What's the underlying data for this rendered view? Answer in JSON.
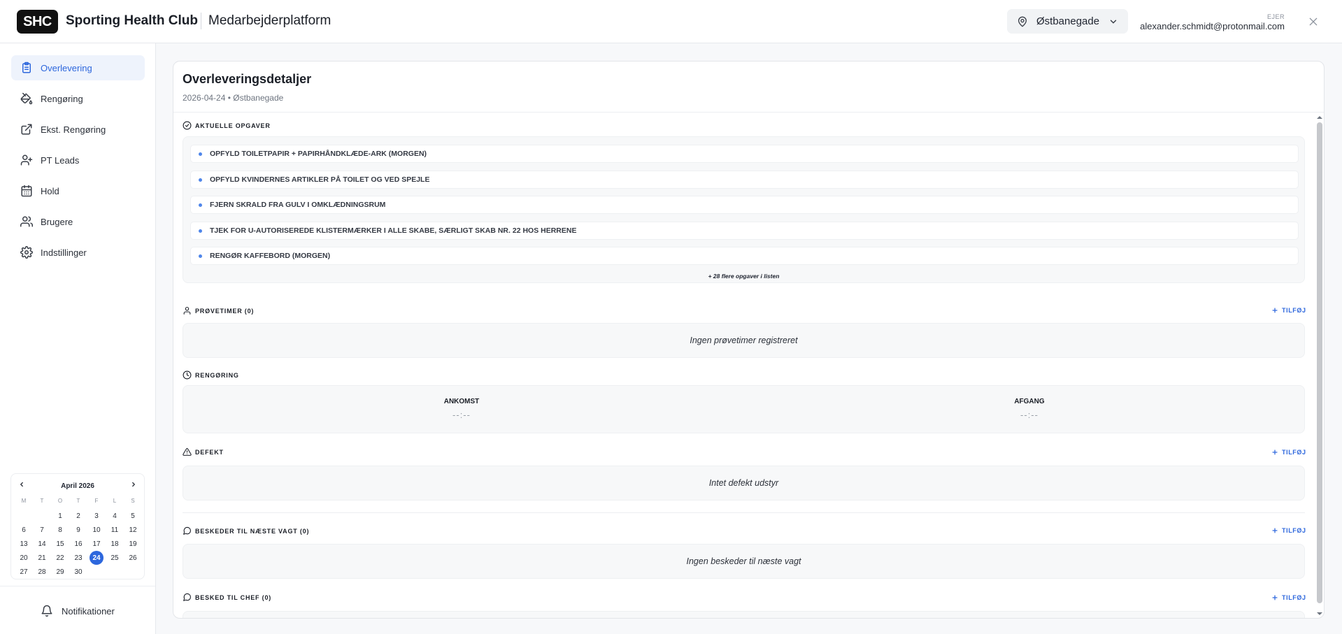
{
  "header": {
    "logo": "SHC",
    "brand": "Sporting Health Club",
    "platform": "Medarbejderplatform",
    "location": "Østbanegade",
    "role": "EJER",
    "email": "alexander.schmidt@protonmail.com"
  },
  "sidebar": {
    "items": [
      {
        "label": "Overlevering",
        "icon": "clipboard-icon",
        "active": true
      },
      {
        "label": "Rengøring",
        "icon": "paint-bucket-icon"
      },
      {
        "label": "Ekst. Rengøring",
        "icon": "external-link-icon"
      },
      {
        "label": "PT Leads",
        "icon": "user-plus-icon"
      },
      {
        "label": "Hold",
        "icon": "calendar-icon"
      },
      {
        "label": "Brugere",
        "icon": "users-icon"
      },
      {
        "label": "Indstillinger",
        "icon": "gear-icon"
      }
    ],
    "notifications": "Notifikationer"
  },
  "calendar": {
    "month": "April 2026",
    "weekdays": [
      "M",
      "T",
      "O",
      "T",
      "F",
      "L",
      "S"
    ],
    "days": [
      "",
      "",
      "1",
      "2",
      "3",
      "4",
      "5",
      "6",
      "7",
      "8",
      "9",
      "10",
      "11",
      "12",
      "13",
      "14",
      "15",
      "16",
      "17",
      "18",
      "19",
      "20",
      "21",
      "22",
      "23",
      "24",
      "25",
      "26",
      "27",
      "28",
      "29",
      "30"
    ],
    "selected": "24"
  },
  "main": {
    "title": "Overleveringsdetaljer",
    "subtitle": "2026-04-24 • Østbanegade",
    "tasks_heading": "AKTUELLE OPGAVER",
    "tasks": [
      "OPFYLD TOILETPAPIR + PAPIRHÅNDKLÆDE-ARK (MORGEN)",
      "OPFYLD KVINDERNES ARTIKLER PÅ TOILET OG VED SPEJLE",
      "FJERN SKRALD FRA GULV I OMKLÆDNINGSRUM",
      "TJEK FOR U-AUTORISEREDE KLISTERMÆRKER I ALLE SKABE, SÆRLIGT SKAB NR. 22 HOS HERRENE",
      "RENGØR KAFFEBORD (MORGEN)"
    ],
    "tasks_more": "+ 28 flere opgaver i listen",
    "trial_heading": "PRØVETIMER (0)",
    "trial_empty": "Ingen prøvetimer registreret",
    "cleaning_heading": "RENGØRING",
    "arrival_label": "ANKOMST",
    "arrival_value": "--:--",
    "departure_label": "AFGANG",
    "departure_value": "--:--",
    "defect_heading": "DEFEKT",
    "defect_empty": "Intet defekt udstyr",
    "messages_heading": "BESKEDER TIL NÆSTE VAGT (0)",
    "messages_empty": "Ingen beskeder til næste vagt",
    "boss_heading": "BESKED TIL CHEF (0)",
    "add_label": "TILFØJ"
  },
  "colors": {
    "accent": "#2d67dd",
    "text": "#1f2430"
  }
}
